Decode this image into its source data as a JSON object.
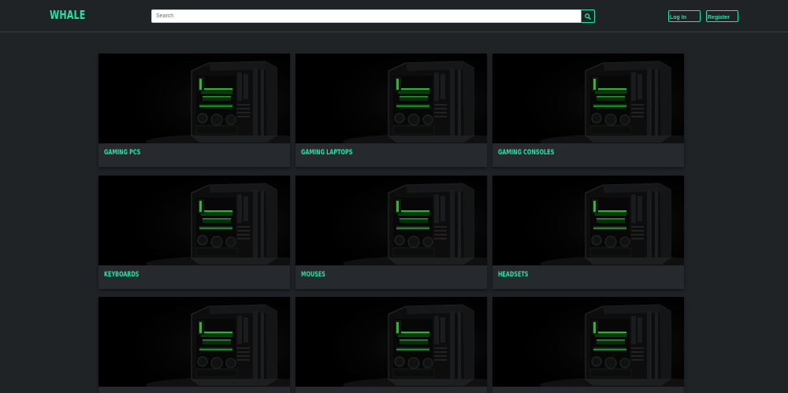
{
  "header": {
    "logo": "WHALE",
    "search_placeholder": "Search",
    "search_icon": "search-icon",
    "login_label": "Log In",
    "register_label": "Register"
  },
  "colors": {
    "accent": "#1de6a0",
    "background": "#1f2326",
    "card": "#262a2e"
  },
  "categories": [
    {
      "title": "GAMING PCS"
    },
    {
      "title": "GAMING LAPTOPS"
    },
    {
      "title": "GAMING CONSOLES"
    },
    {
      "title": "KEYBOARDS"
    },
    {
      "title": "MOUSES"
    },
    {
      "title": "HEADSETS"
    },
    {
      "title": ""
    },
    {
      "title": ""
    },
    {
      "title": ""
    }
  ]
}
